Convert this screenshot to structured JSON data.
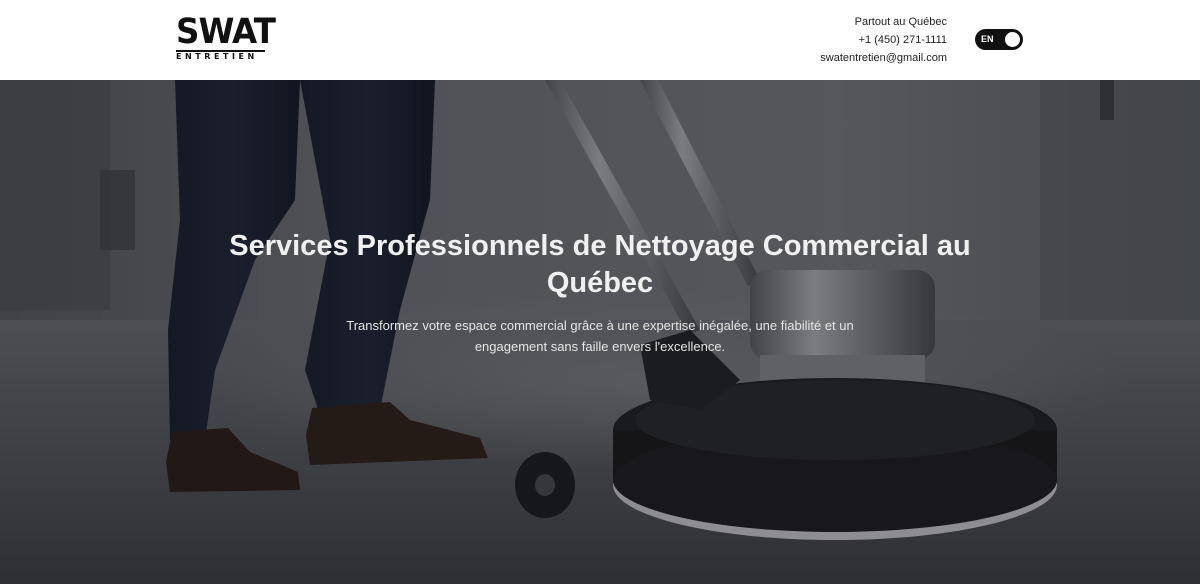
{
  "header": {
    "logo": {
      "main": "SWAT",
      "sub": "ENTRETIEN"
    },
    "contact": {
      "location": "Partout au Québec",
      "phone": "+1 (450) 271-1111",
      "email": "swatentretien@gmail.com"
    },
    "language_toggle": {
      "label": "EN"
    }
  },
  "hero": {
    "title": "Services Professionnels de Nettoyage Commercial au Québec",
    "subtitle": "Transformez votre espace commercial grâce à une expertise inégalée, une fiabilité et un engagement sans faille envers l'excellence."
  },
  "colors": {
    "header_bg": "#ffffff",
    "brand": "#111111",
    "hero_text": "#f0f0f0"
  }
}
